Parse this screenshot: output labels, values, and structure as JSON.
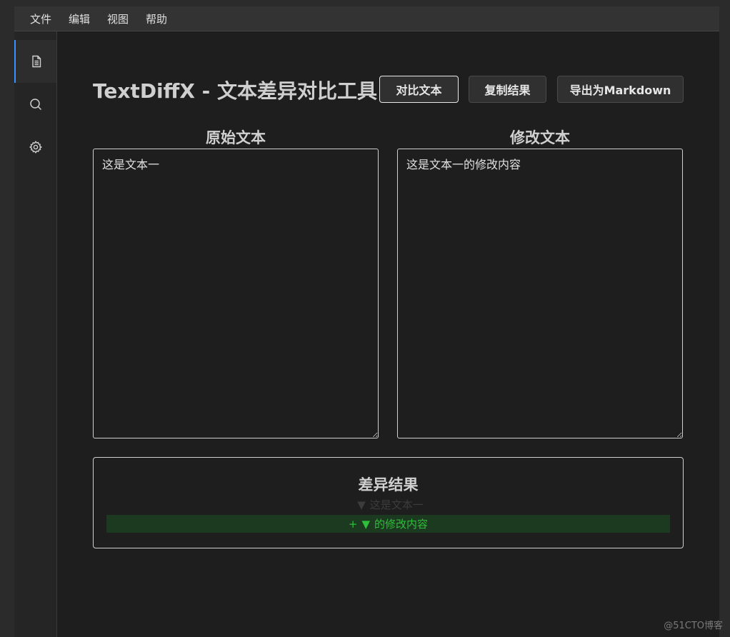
{
  "menu": {
    "items": [
      "文件",
      "编辑",
      "视图",
      "帮助"
    ]
  },
  "activitybar": {
    "icons": [
      "file-icon",
      "search-icon",
      "gear-icon"
    ],
    "active": "file-icon",
    "accent": "#3794ff"
  },
  "header": {
    "title": "TextDiffX - 文本差异对比工具"
  },
  "toolbar": {
    "compare_label": "对比文本",
    "copy_label": "复制结果",
    "export_label": "导出为Markdown"
  },
  "panes": {
    "original": {
      "label": "原始文本",
      "value": "这是文本一"
    },
    "modified": {
      "label": "修改文本",
      "value": "这是文本一的修改内容"
    }
  },
  "result": {
    "title": "差异结果",
    "lines": [
      {
        "type": "unchanged",
        "prefix": "",
        "marker": "▼",
        "text": "这是文本一"
      },
      {
        "type": "added",
        "prefix": "+",
        "marker": "▼",
        "text": "的修改内容"
      }
    ],
    "added_color": "#2fbf3a",
    "added_bg": "#1b3a1f"
  },
  "watermark": "@51CTO博客"
}
